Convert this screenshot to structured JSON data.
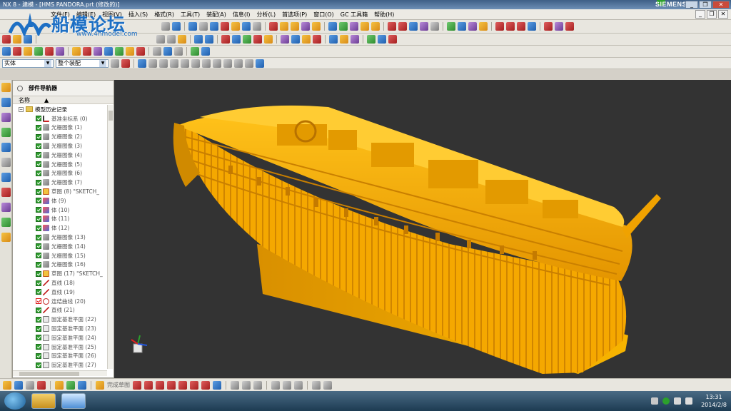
{
  "window": {
    "title": "NX 8 - 建模 - [HMS PANDORA.prt (修改的)]",
    "brand": "SIEMENS",
    "controls": [
      "_",
      "❐",
      "✕"
    ]
  },
  "watermark": {
    "title": "船模论坛",
    "url": "www.4hmodel.com"
  },
  "menu": {
    "items": [
      "文件(F)",
      "编辑(E)",
      "视图(V)",
      "插入(S)",
      "格式(R)",
      "工具(T)",
      "装配(A)",
      "信息(I)",
      "分析(L)",
      "首选项(P)",
      "窗口(O)",
      "GC 工具箱",
      "帮助(H)"
    ]
  },
  "selection_bar": {
    "filter_value": "实体",
    "scope_value": "整个装配"
  },
  "navigator": {
    "title": "部件导航器",
    "column_name": "名称",
    "root_label": "模型历史记录",
    "nodes": [
      {
        "label": "基准坐标系 (0)",
        "icon": "datum-csys-icon"
      },
      {
        "label": "光栅图像 (1)",
        "icon": "raster-image-icon"
      },
      {
        "label": "光栅图像 (2)",
        "icon": "raster-image-icon"
      },
      {
        "label": "光栅图像 (3)",
        "icon": "raster-image-icon"
      },
      {
        "label": "光栅图像 (4)",
        "icon": "raster-image-icon"
      },
      {
        "label": "光栅图像 (5)",
        "icon": "raster-image-icon"
      },
      {
        "label": "光栅图像 (6)",
        "icon": "raster-image-icon"
      },
      {
        "label": "光栅图像 (7)",
        "icon": "raster-image-icon"
      },
      {
        "label": "草图 (8) \"SKETCH_",
        "icon": "sketch-icon"
      },
      {
        "label": "体 (9)",
        "icon": "body-icon"
      },
      {
        "label": "体 (10)",
        "icon": "body-icon"
      },
      {
        "label": "体 (11)",
        "icon": "body-icon"
      },
      {
        "label": "体 (12)",
        "icon": "body-icon"
      },
      {
        "label": "光栅图像 (13)",
        "icon": "raster-image-icon"
      },
      {
        "label": "光栅图像 (14)",
        "icon": "raster-image-icon"
      },
      {
        "label": "光栅图像 (15)",
        "icon": "raster-image-icon"
      },
      {
        "label": "光栅图像 (16)",
        "icon": "raster-image-icon"
      },
      {
        "label": "草图 (17) \"SKETCH_",
        "icon": "sketch-icon"
      },
      {
        "label": "直线 (18)",
        "icon": "line-icon"
      },
      {
        "label": "直线 (19)",
        "icon": "line-icon"
      },
      {
        "label": "连结曲线 (20)",
        "icon": "curve-icon",
        "warning": true
      },
      {
        "label": "直线 (21)",
        "icon": "line-icon"
      },
      {
        "label": "固定基准平面 (22)",
        "icon": "datum-plane-icon"
      },
      {
        "label": "固定基准平面 (23)",
        "icon": "datum-plane-icon"
      },
      {
        "label": "固定基准平面 (24)",
        "icon": "datum-plane-icon"
      },
      {
        "label": "固定基准平面 (25)",
        "icon": "datum-plane-icon"
      },
      {
        "label": "固定基准平面 (26)",
        "icon": "datum-plane-icon"
      },
      {
        "label": "固定基准平面 (27)",
        "icon": "datum-plane-icon"
      }
    ]
  },
  "bottom_toolbar": {
    "finish_sketch_label": "完成草图"
  },
  "taskbar": {
    "time": "13:31",
    "date": "2014/2/8"
  },
  "colors": {
    "viewport_bg": "#333333",
    "model": "#f5a800",
    "model_dark": "#c77d00",
    "model_light": "#ffcc33"
  }
}
